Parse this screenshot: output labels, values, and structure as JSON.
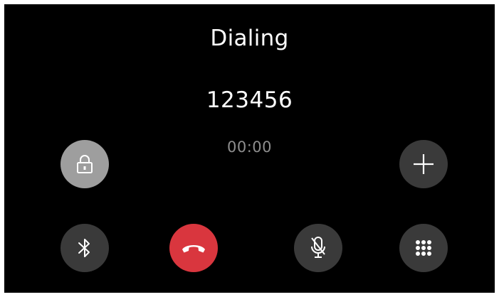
{
  "call": {
    "status": "Dialing",
    "number": "123456",
    "duration": "00:00"
  },
  "controls": {
    "lock": {
      "icon": "lock-icon",
      "color": "#9e9e9e"
    },
    "add_call": {
      "icon": "plus-icon",
      "color": "#3a3a3a"
    },
    "bluetooth": {
      "icon": "bluetooth-icon",
      "color": "#3a3a3a"
    },
    "end_call": {
      "icon": "phone-hangup-icon",
      "color": "#d9363e"
    },
    "mute": {
      "icon": "microphone-off-icon",
      "color": "#3a3a3a"
    },
    "keypad": {
      "icon": "dialpad-icon",
      "color": "#3a3a3a"
    }
  },
  "colors": {
    "background": "#000000",
    "text_primary": "#ffffff",
    "text_secondary": "#8e8e8e"
  }
}
